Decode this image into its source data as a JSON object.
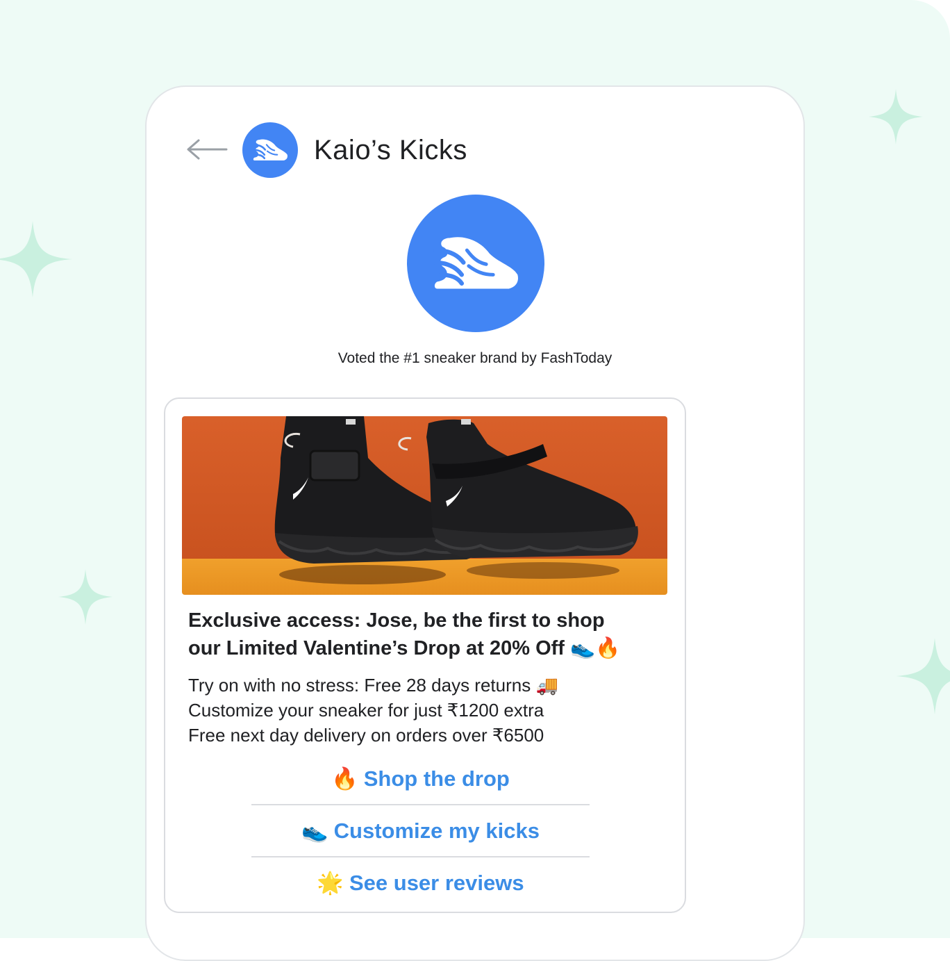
{
  "header": {
    "brand_name": "Kaio’s Kicks"
  },
  "profile": {
    "tagline": "Voted the #1 sneaker brand by FashToday"
  },
  "card": {
    "headline_line1": "Exclusive access: Jose, be the first to shop",
    "headline_line2": "our Limited Valentine’s Drop at 20% Off 👟🔥",
    "body_lines": [
      "Try on with no stress: Free 28 days returns 🚚",
      "Customize your sneaker for just ₹1200 extra",
      "Free next day delivery on orders over ₹6500"
    ],
    "actions": [
      {
        "emoji": "🔥",
        "label": "Shop the drop"
      },
      {
        "emoji": "👟",
        "label": "Customize my kicks"
      },
      {
        "emoji": "🌟",
        "label": "See user reviews"
      }
    ]
  },
  "colors": {
    "brand_blue": "#4285f4",
    "action_blue": "#3b8de6",
    "background_mint": "#eefbf6",
    "sparkle_mint": "#c9f0df",
    "hero_orange": "#d9602a"
  }
}
